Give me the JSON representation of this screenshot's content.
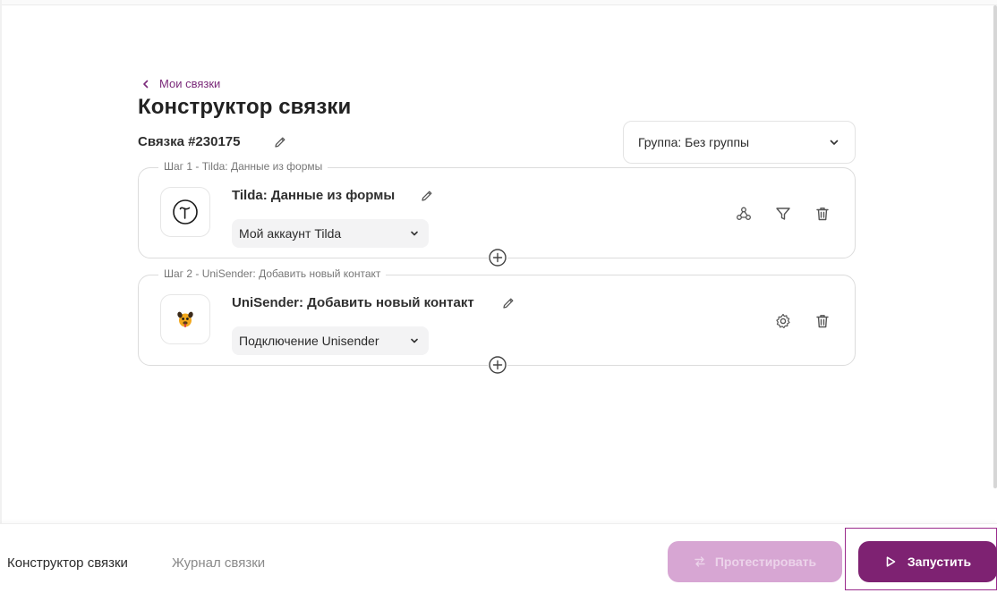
{
  "breadcrumb": {
    "back_label": "Мои связки"
  },
  "page": {
    "title": "Конструктор связки"
  },
  "connection": {
    "id_label": "Связка #230175"
  },
  "group_select": {
    "value": "Группа: Без группы"
  },
  "steps": [
    {
      "legend": "Шаг 1 - Tilda: Данные из формы",
      "name": "Tilda: Данные из формы",
      "account": "Мой аккаунт Tilda",
      "icon": "tilda-logo-icon",
      "actions": [
        "webhook-icon",
        "filter-icon",
        "trash-icon"
      ]
    },
    {
      "legend": "Шаг 2 - UniSender: Добавить новый контакт",
      "name": "UniSender: Добавить новый контакт",
      "account": "Подключение Unisender",
      "icon": "unisender-logo-icon",
      "actions": [
        "gear-icon",
        "trash-icon"
      ]
    }
  ],
  "footer": {
    "tabs": [
      {
        "label": "Конструктор связки",
        "active": true
      },
      {
        "label": "Журнал связки",
        "active": false
      }
    ],
    "test_button": {
      "label": "Протестировать",
      "disabled": true
    },
    "run_button": {
      "label": "Запустить"
    }
  },
  "colors": {
    "accent": "#7e2272",
    "accent_disabled": "#d7a6d3",
    "link": "#7b2a7a",
    "border": "#dcdcdc"
  }
}
